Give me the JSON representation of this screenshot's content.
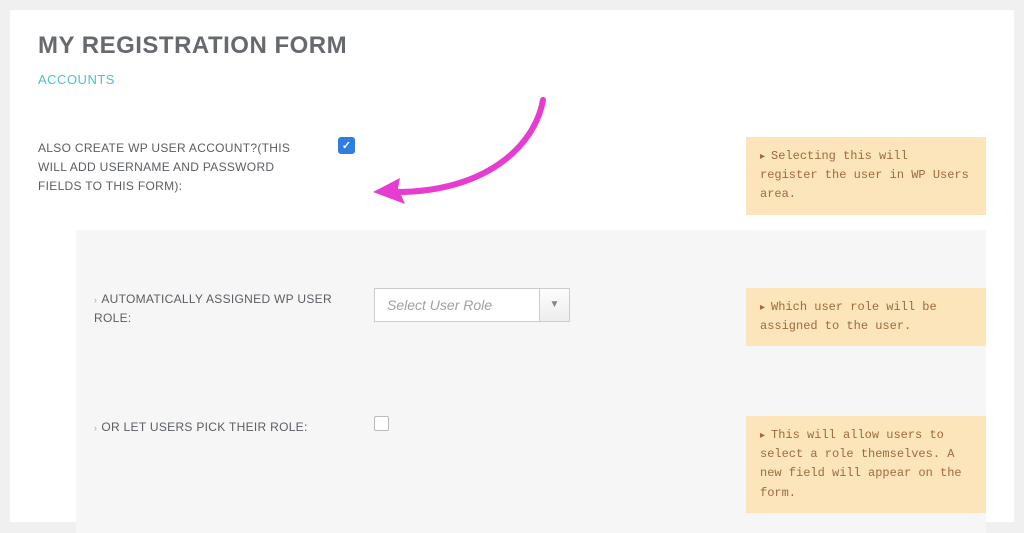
{
  "page": {
    "title": "MY REGISTRATION FORM",
    "tab": "ACCOUNTS"
  },
  "fields": {
    "createAccount": {
      "label": "ALSO CREATE WP USER ACCOUNT?(THIS WILL ADD USERNAME AND PASSWORD FIELDS TO THIS FORM):",
      "hint": "Selecting this will register the user in WP Users area."
    },
    "assignedRole": {
      "label": "AUTOMATICALLY ASSIGNED WP USER ROLE:",
      "placeholder": "Select User Role",
      "hint": "Which user role will be assigned to the user."
    },
    "pickRole": {
      "label": "OR LET USERS PICK THEIR ROLE:",
      "hint": "This will allow users to select a role themselves. A new field will appear on the form."
    }
  }
}
